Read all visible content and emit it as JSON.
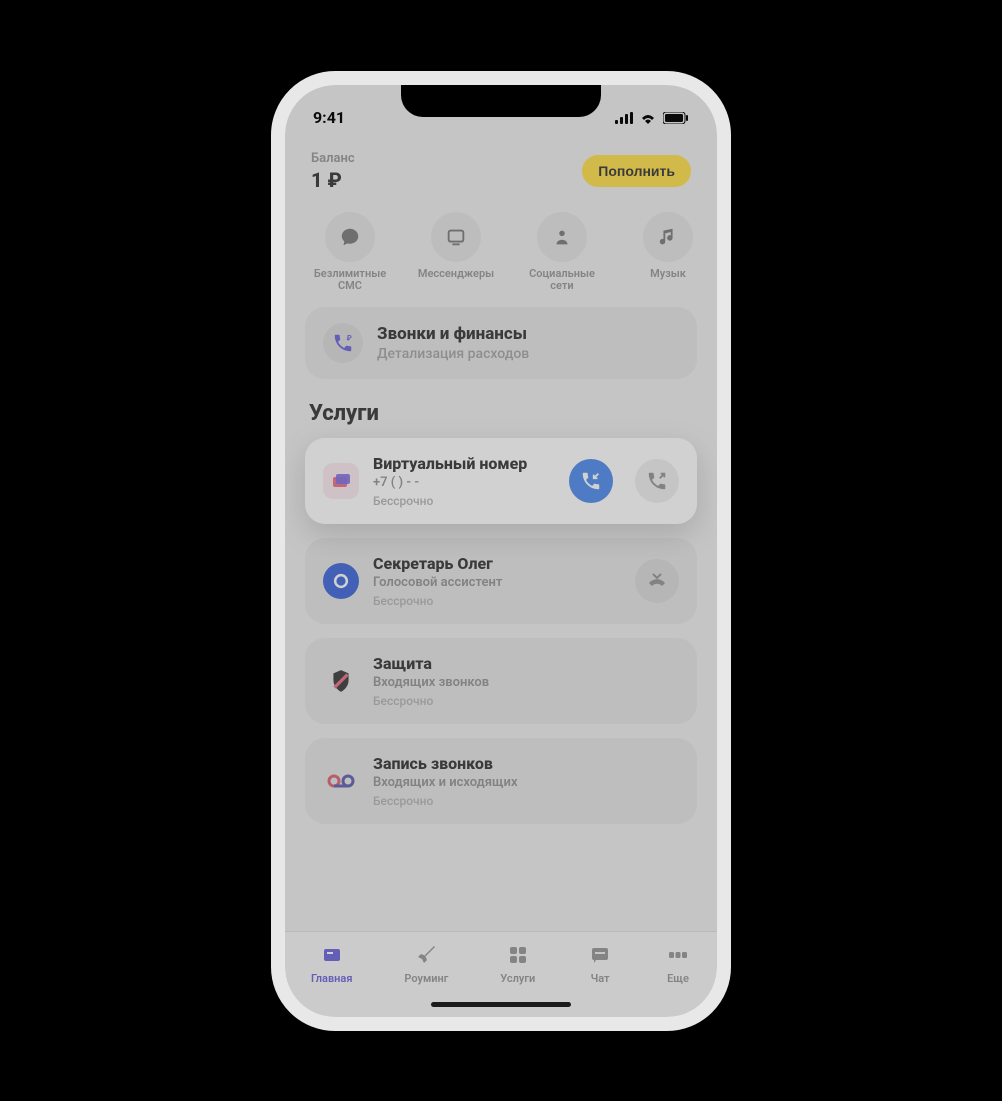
{
  "status": {
    "time": "9:41"
  },
  "balance": {
    "label": "Баланс",
    "value": "1 ₽",
    "topup": "Пополнить"
  },
  "chips": [
    {
      "label": "Безлимитные СМС",
      "icon": "chat"
    },
    {
      "label": "Мессенджеры",
      "icon": "messenger"
    },
    {
      "label": "Социальные сети",
      "icon": "social"
    },
    {
      "label": "Музык",
      "icon": "music"
    }
  ],
  "banner": {
    "title": "Звонки и финансы",
    "subtitle": "Детализация расходов"
  },
  "section_title": "Услуги",
  "services": [
    {
      "title": "Виртуальный номер",
      "subtitle": "+7 (   )    -  -  ",
      "footer": "Бессрочно",
      "highlight": true,
      "icon_color": "#E85D7A",
      "action_incoming": true,
      "action_outgoing": true
    },
    {
      "title": "Секретарь Олег",
      "subtitle": "Голосовой ассистент",
      "footer": "Бессрочно",
      "highlight": false,
      "icon_color": "#2654D6",
      "action_missed": true
    },
    {
      "title": "Защита",
      "subtitle": "Входящих звонков",
      "footer": "Бессрочно",
      "highlight": false,
      "icon_color": "#222"
    },
    {
      "title": "Запись звонков",
      "subtitle": "Входящих и исходящих",
      "footer": "Бессрочно",
      "highlight": false,
      "icon_color": "#D94F64"
    }
  ],
  "tabs": [
    {
      "label": "Главная",
      "active": true
    },
    {
      "label": "Роуминг",
      "active": false
    },
    {
      "label": "Услуги",
      "active": false
    },
    {
      "label": "Чат",
      "active": false
    },
    {
      "label": "Еще",
      "active": false
    }
  ]
}
